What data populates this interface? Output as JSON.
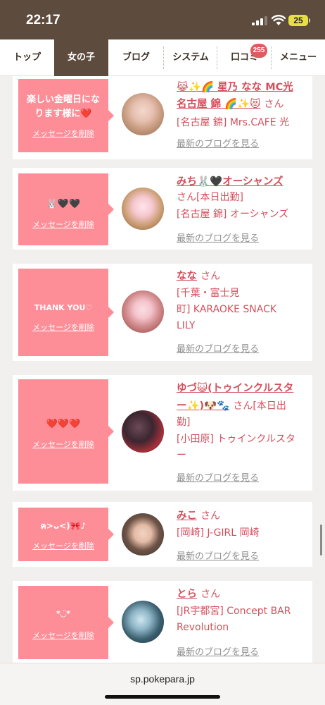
{
  "status": {
    "time": "22:17",
    "battery": "25"
  },
  "nav": {
    "tabs": [
      {
        "label": "トップ"
      },
      {
        "label": "女の子"
      },
      {
        "label": "ブログ"
      },
      {
        "label": "システム"
      },
      {
        "label": "口コミ"
      },
      {
        "label": "メニュー"
      }
    ],
    "review_badge": "255"
  },
  "delete_label": "メッセージを削除",
  "blog_label": "最新のブログを見る",
  "san": "さん",
  "entries": [
    {
      "message": [
        "楽しい金曜日にな",
        "ります様に❤️"
      ],
      "name_lines": [
        "😹✨🌈 星乃 なな MC光",
        "名古屋 錦 🌈✨😻"
      ],
      "name_tail": "さん",
      "shop_lines": [
        "[名古屋 錦] Mrs.CAFE 光"
      ]
    },
    {
      "message": [
        "🐰🖤🖤"
      ],
      "name_lines": [
        "みち🐰🖤オーシャンズ"
      ],
      "name_tail": "さん[本日出勤]",
      "shop_lines": [
        "[名古屋 錦] オーシャンズ"
      ]
    },
    {
      "message": [
        "THANK YOU♡"
      ],
      "name_lines": [
        "なな"
      ],
      "name_tail": "さん",
      "shop_lines": [
        "[千葉・富士見",
        "町] KARAOKE SNACK",
        "LILY"
      ]
    },
    {
      "message": [
        "❤️❤️❤️"
      ],
      "name_lines": [
        "ゆづ😺(トゥインクルスタ",
        "ー✨)🐶🐾"
      ],
      "name_tail": "さん[本日出",
      "name_tail2": "勤]",
      "shop_lines": [
        "[小田原] トゥインクルスタ",
        "ー"
      ]
    },
    {
      "message": [
        "ฅ>ᴗ<)🎀♪"
      ],
      "name_lines": [
        "みこ"
      ],
      "name_tail": "さん",
      "shop_lines": [
        "[岡崎] J-GIRL 岡崎"
      ]
    },
    {
      "message": [
        "*◡̈*"
      ],
      "name_lines": [
        "とら"
      ],
      "name_tail": "さん",
      "shop_lines": [
        "[JR宇都宮] Concept BAR",
        "Revolution"
      ]
    }
  ],
  "browser": {
    "url": "sp.pokepara.jp"
  }
}
